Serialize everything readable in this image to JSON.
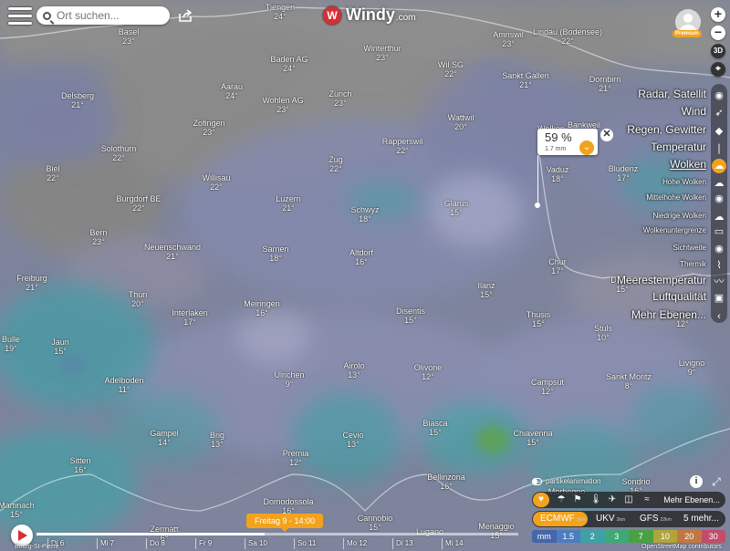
{
  "app": {
    "brand": "Windy",
    "domain": ".com",
    "premium_badge": "Premium"
  },
  "search": {
    "placeholder": "Ort suchen..."
  },
  "zoom": {
    "in": "+",
    "out": "−",
    "mode3d": "3D"
  },
  "layers": [
    {
      "label": "Radar, Satellit",
      "size": "big"
    },
    {
      "label": "Wind",
      "size": "big"
    },
    {
      "label": "Regen, Gewitter",
      "size": "big"
    },
    {
      "label": "Temperatur",
      "size": "big"
    },
    {
      "label": "Wolken",
      "size": "big",
      "selected": true
    },
    {
      "label": "Hohe Wolken",
      "size": "small"
    },
    {
      "label": "Mittelhohe Wolken",
      "size": "small"
    },
    {
      "label": "Niedrige Wolken",
      "size": "small"
    },
    {
      "label": "Wolkenuntergrenze",
      "size": "small"
    },
    {
      "label": "Sichtweite",
      "size": "small"
    },
    {
      "label": "Thermik",
      "size": "small"
    },
    {
      "label": "Meerestemperatur",
      "size": "big"
    },
    {
      "label": "Luftqualität",
      "size": "big"
    },
    {
      "label": "Mehr Ebenen...",
      "size": "big"
    }
  ],
  "popup": {
    "value": "59 %",
    "amount": "1.7 mm",
    "close": "✕",
    "expand": "⌄"
  },
  "overlay_bar": {
    "more": "Mehr Ebenen..."
  },
  "models": {
    "ecmwf": "ECMWF",
    "ecmwf_res": "9km",
    "ukv": "UKV",
    "ukv_res": "2km",
    "gfs": "GFS",
    "gfs_res": "22km",
    "more": "5 mehr..."
  },
  "particle_label": "partikelanimation",
  "legend": {
    "unit": "mm",
    "steps": [
      {
        "v": "1.5",
        "c": "#4c7cc2"
      },
      {
        "v": "2",
        "c": "#3ea1a8"
      },
      {
        "v": "3",
        "c": "#3fa873"
      },
      {
        "v": "7",
        "c": "#4aa043"
      },
      {
        "v": "10",
        "c": "#b1a53a"
      },
      {
        "v": "20",
        "c": "#c27743"
      },
      {
        "v": "30",
        "c": "#c34c6a"
      }
    ],
    "unit_color": "#4566a9"
  },
  "attribution": "OpenStreetMap contributors",
  "timeline": {
    "current": "Freitag 9 - 14:00",
    "days": [
      "Di 6",
      "Mi 7",
      "Do 8",
      "Fr 9",
      "Sa 10",
      "So 11",
      "Mo 12",
      "Di 13",
      "Mi 14"
    ],
    "left_label": "Bourg-St-Pierre"
  },
  "colors": {
    "accent": "#f3a21d",
    "brand": "#d62f36"
  },
  "cities": [
    {
      "name": "Tiengen",
      "temp": "24°"
    },
    {
      "name": "Basel",
      "temp": "23°"
    },
    {
      "name": "Baden AG",
      "temp": "24°"
    },
    {
      "name": "Winterthur",
      "temp": "23°"
    },
    {
      "name": "Amriswil",
      "temp": "23°"
    },
    {
      "name": "Lindau (Bodensee)",
      "temp": "22°"
    },
    {
      "name": "Aarau",
      "temp": "24°"
    },
    {
      "name": "Wohlen AG",
      "temp": "23°"
    },
    {
      "name": "Zürich",
      "temp": "23°"
    },
    {
      "name": "Wil SG",
      "temp": "22°"
    },
    {
      "name": "Sankt Gallen",
      "temp": "21°"
    },
    {
      "name": "Dornbirn",
      "temp": "21°"
    },
    {
      "name": "Delsberg",
      "temp": "21°"
    },
    {
      "name": "Zofingen",
      "temp": "23°"
    },
    {
      "name": "Wattwil",
      "temp": "20°"
    },
    {
      "name": "Solothurn",
      "temp": "22°"
    },
    {
      "name": "Rapperswil",
      "temp": "22°"
    },
    {
      "name": "Biel",
      "temp": "22°"
    },
    {
      "name": "Willisau",
      "temp": "22°"
    },
    {
      "name": "Zug",
      "temp": "22°"
    },
    {
      "name": "Bludenz",
      "temp": "17°"
    },
    {
      "name": "Burgdorf BE",
      "temp": "22°"
    },
    {
      "name": "Luzern",
      "temp": "21°"
    },
    {
      "name": "Schwyz",
      "temp": "18°"
    },
    {
      "name": "Glarus",
      "temp": "15°"
    },
    {
      "name": "Vaduz",
      "temp": "18°"
    },
    {
      "name": "Bankweil",
      "temp": ""
    },
    {
      "name": "Wolken",
      "temp": ""
    },
    {
      "name": "Bern",
      "temp": "23°"
    },
    {
      "name": "Neuenschwand",
      "temp": "21°"
    },
    {
      "name": "Sarnen",
      "temp": "18°"
    },
    {
      "name": "Altdorf",
      "temp": "16°"
    },
    {
      "name": "Chur",
      "temp": "17°"
    },
    {
      "name": "Freiburg",
      "temp": "21°"
    },
    {
      "name": "Thun",
      "temp": "20°"
    },
    {
      "name": "Ilanz",
      "temp": "15°"
    },
    {
      "name": "Davos",
      "temp": "15°"
    },
    {
      "name": "Interlaken",
      "temp": "17°"
    },
    {
      "name": "Meiringen",
      "temp": "16°"
    },
    {
      "name": "Disentis",
      "temp": "15°"
    },
    {
      "name": "Thusis",
      "temp": "15°"
    },
    {
      "name": "Zernez",
      "temp": "12°"
    },
    {
      "name": "Bulle",
      "temp": "19°"
    },
    {
      "name": "Jaun",
      "temp": "15°"
    },
    {
      "name": "Stuls",
      "temp": "10°"
    },
    {
      "name": "Adelboden",
      "temp": "11°"
    },
    {
      "name": "Ulrichen",
      "temp": "9°"
    },
    {
      "name": "Airolo",
      "temp": "13°"
    },
    {
      "name": "Olivone",
      "temp": "12°"
    },
    {
      "name": "Campsut",
      "temp": "12°"
    },
    {
      "name": "Sankt Moritz",
      "temp": "8°"
    },
    {
      "name": "Livigno",
      "temp": "9°"
    },
    {
      "name": "Gampel",
      "temp": "14°"
    },
    {
      "name": "Brig",
      "temp": "13°"
    },
    {
      "name": "Biasca",
      "temp": "15°"
    },
    {
      "name": "Cevio",
      "temp": "13°"
    },
    {
      "name": "Chiavenna",
      "temp": "15°"
    },
    {
      "name": "Sitten",
      "temp": "16°"
    },
    {
      "name": "Premia",
      "temp": "12°"
    },
    {
      "name": "Bellinzona",
      "temp": "16°"
    },
    {
      "name": "Sondrio",
      "temp": "16°"
    },
    {
      "name": "Martinach",
      "temp": "15°"
    },
    {
      "name": "Domodossola",
      "temp": "16°"
    },
    {
      "name": "Morbegno",
      "temp": ""
    },
    {
      "name": "Zermatt",
      "temp": "6°"
    },
    {
      "name": "Cannobio",
      "temp": "15°"
    },
    {
      "name": "Menaggio",
      "temp": "15°"
    },
    {
      "name": "Lugano",
      "temp": ""
    }
  ]
}
